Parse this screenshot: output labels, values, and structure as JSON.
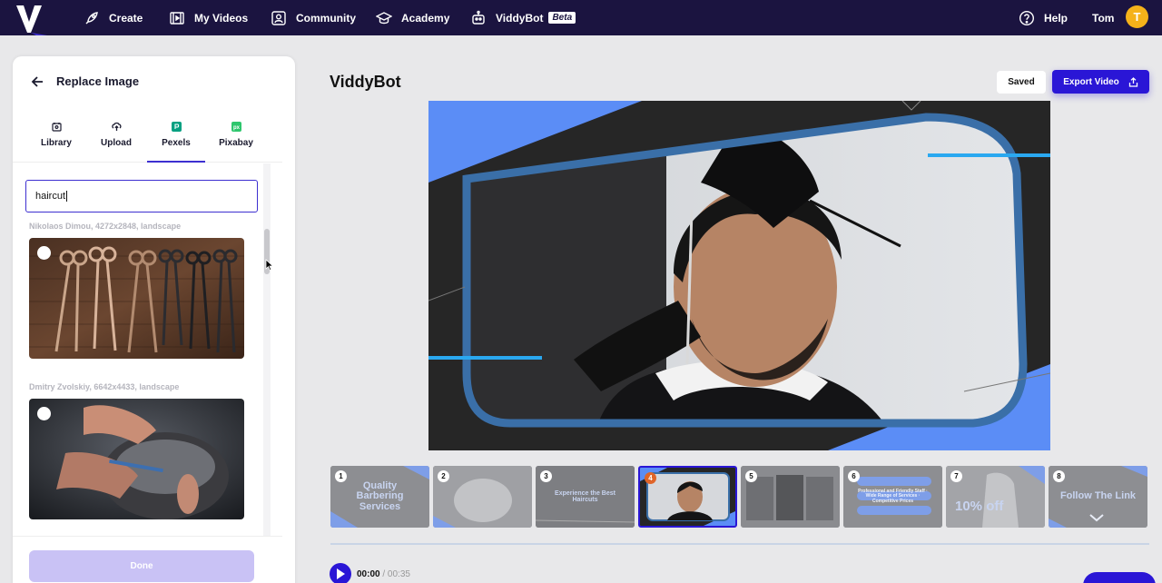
{
  "nav": {
    "items": [
      {
        "label": "Create",
        "icon": "rocket-icon"
      },
      {
        "label": "My Videos",
        "icon": "video-icon"
      },
      {
        "label": "Community",
        "icon": "community-icon"
      },
      {
        "label": "Academy",
        "icon": "graduation-cap-icon"
      },
      {
        "label": "ViddyBot",
        "icon": "robot-icon",
        "badge": "Beta"
      }
    ],
    "help": "Help",
    "user": "Tom",
    "avatar_initial": "T"
  },
  "panel": {
    "title": "Replace Image",
    "tabs": [
      {
        "label": "Library",
        "active": false
      },
      {
        "label": "Upload",
        "active": false
      },
      {
        "label": "Pexels",
        "active": true
      },
      {
        "label": "Pixabay",
        "active": false
      }
    ],
    "search_value": "haircut",
    "results": [
      {
        "credit": "Nikolaos Dimou, 4272x2848, landscape",
        "subject": "scissors on wood wall"
      },
      {
        "credit": "Dmitry Zvolskiy, 6642x4433, landscape",
        "subject": "barber cutting hair"
      }
    ],
    "done_label": "Done"
  },
  "main": {
    "title": "ViddyBot",
    "saved_label": "Saved",
    "export_label": "Export Video",
    "scenes": [
      {
        "num": "1",
        "text": "Quality Barbering Services"
      },
      {
        "num": "2",
        "text": ""
      },
      {
        "num": "3",
        "text": "Experience the Best Haircuts"
      },
      {
        "num": "4",
        "text": ""
      },
      {
        "num": "5",
        "text": ""
      },
      {
        "num": "6",
        "text": "Professional and Friendly Staff · Wide Range of Services · Competitive Prices"
      },
      {
        "num": "7",
        "text": "10% off"
      },
      {
        "num": "8",
        "text": "Follow The Link"
      }
    ],
    "active_scene": 4,
    "time_current": "00:00",
    "time_total": "/ 00:35"
  },
  "colors": {
    "nav_bg": "#1b1440",
    "accent": "#2a16d6",
    "frame_blue": "#5b8df6",
    "avatar": "#f5b21a"
  }
}
